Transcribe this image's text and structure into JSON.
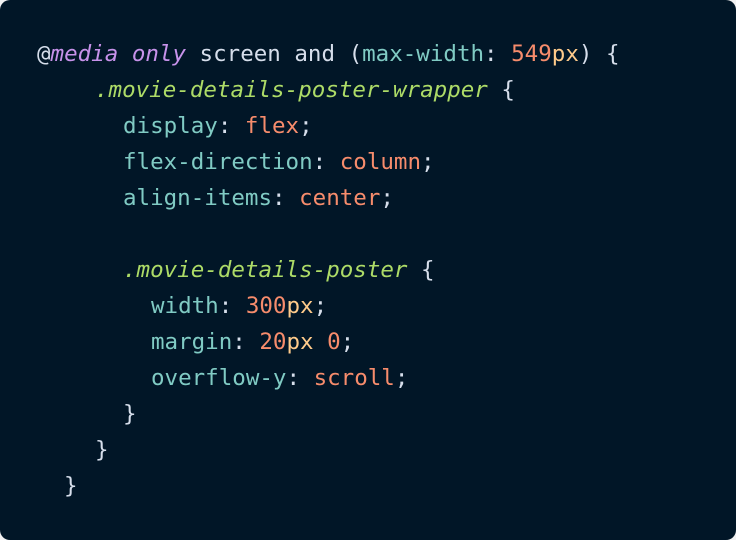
{
  "theme": {
    "background": "#011627",
    "token_colors": {
      "plain": "#d6deeb",
      "at": "#d6deeb",
      "keyword": "#c792ea",
      "prop": "#80cbc4",
      "number": "#f78c6c",
      "unit": "#ffcb8b",
      "value": "#f78c6c",
      "selector": "#addb67",
      "punct": "#d6deeb",
      "muted": "#9aa9c0"
    }
  },
  "code": {
    "language": "css",
    "lines": [
      {
        "indent": "",
        "tokens": [
          {
            "t": "@",
            "k": "at"
          },
          {
            "t": "media",
            "k": "keyword",
            "italic": true
          },
          {
            "t": " ",
            "k": "plain"
          },
          {
            "t": "only",
            "k": "keyword",
            "italic": true
          },
          {
            "t": " screen ",
            "k": "plain"
          },
          {
            "t": "and",
            "k": "plain"
          },
          {
            "t": " (",
            "k": "plain"
          },
          {
            "t": "max-width",
            "k": "prop"
          },
          {
            "t": ": ",
            "k": "plain"
          },
          {
            "t": "549",
            "k": "number"
          },
          {
            "t": "px",
            "k": "unit"
          },
          {
            "t": ") {",
            "k": "plain"
          }
        ]
      },
      {
        "indent": "  ",
        "tokens": [
          {
            "t": ".movie-details-poster-wrapper",
            "k": "selector",
            "italic": true
          },
          {
            "t": " {",
            "k": "plain"
          }
        ]
      },
      {
        "indent": "   ",
        "tokens": [
          {
            "t": "display",
            "k": "prop"
          },
          {
            "t": ": ",
            "k": "plain"
          },
          {
            "t": "flex",
            "k": "value"
          },
          {
            "t": ";",
            "k": "plain"
          }
        ]
      },
      {
        "indent": "   ",
        "tokens": [
          {
            "t": "flex-direction",
            "k": "prop"
          },
          {
            "t": ": ",
            "k": "plain"
          },
          {
            "t": "column",
            "k": "value"
          },
          {
            "t": ";",
            "k": "plain"
          }
        ]
      },
      {
        "indent": "   ",
        "tokens": [
          {
            "t": "align-items",
            "k": "prop"
          },
          {
            "t": ": ",
            "k": "plain"
          },
          {
            "t": "center",
            "k": "value"
          },
          {
            "t": ";",
            "k": "plain"
          }
        ]
      },
      {
        "indent": "",
        "tokens": []
      },
      {
        "indent": "   ",
        "tokens": [
          {
            "t": ".movie-details-poster",
            "k": "selector",
            "italic": true
          },
          {
            "t": " {",
            "k": "plain"
          }
        ]
      },
      {
        "indent": "    ",
        "tokens": [
          {
            "t": "width",
            "k": "prop"
          },
          {
            "t": ": ",
            "k": "plain"
          },
          {
            "t": "300",
            "k": "number"
          },
          {
            "t": "px",
            "k": "unit"
          },
          {
            "t": ";",
            "k": "plain"
          }
        ]
      },
      {
        "indent": "    ",
        "tokens": [
          {
            "t": "margin",
            "k": "prop"
          },
          {
            "t": ": ",
            "k": "plain"
          },
          {
            "t": "20",
            "k": "number"
          },
          {
            "t": "px ",
            "k": "unit"
          },
          {
            "t": "0",
            "k": "number"
          },
          {
            "t": ";",
            "k": "plain"
          }
        ]
      },
      {
        "indent": "    ",
        "tokens": [
          {
            "t": "overflow-y",
            "k": "prop"
          },
          {
            "t": ": ",
            "k": "plain"
          },
          {
            "t": "scroll",
            "k": "value"
          },
          {
            "t": ";",
            "k": "plain"
          }
        ]
      },
      {
        "indent": "   ",
        "tokens": [
          {
            "t": "}",
            "k": "plain"
          }
        ]
      },
      {
        "indent": "  ",
        "tokens": [
          {
            "t": "}",
            "k": "plain"
          }
        ]
      },
      {
        "indent": " ",
        "tokens": [
          {
            "t": "}",
            "k": "plain"
          }
        ]
      }
    ]
  }
}
